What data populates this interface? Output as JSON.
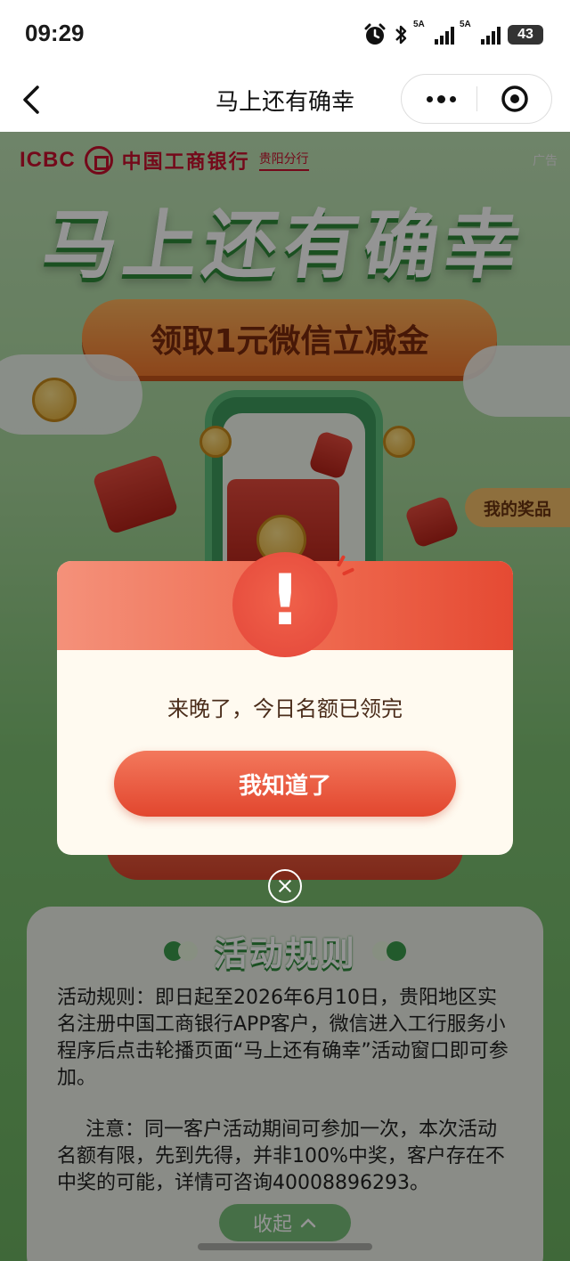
{
  "status_bar": {
    "time": "09:29",
    "sim1_label": "5A",
    "sim2_label": "5A",
    "battery": "43"
  },
  "navbar": {
    "title": "马上还有确幸"
  },
  "banner": {
    "bank_brand": "ICBC",
    "bank_name": "中国工商银行",
    "branch": "贵阳分行",
    "ad_label": "广告",
    "hero_title": "马上还有确幸",
    "subtitle": "领取1元微信立减金",
    "my_prizes": "我的奖品"
  },
  "rules": {
    "heading": "活动规则",
    "body": "活动规则：即日起至2026年6月10日，贵阳地区实名注册中国工商银行APP客户，微信进入工行服务小程序后点击轮播页面“马上还有确幸”活动窗口即可参加。",
    "note": "注意：同一客户活动期间可参加一次，本次活动名额有限，先到先得，并非100%中奖，客户存在不中奖的可能，详情可咨询40008896293。",
    "collapse_label": "收起"
  },
  "modal": {
    "badge": "!",
    "message": "来晚了，今日名额已领完",
    "confirm_label": "我知道了"
  },
  "colors": {
    "brand_red": "#c8102e",
    "modal_accent": "#e54a33",
    "bg_green": "#8cc97f"
  }
}
